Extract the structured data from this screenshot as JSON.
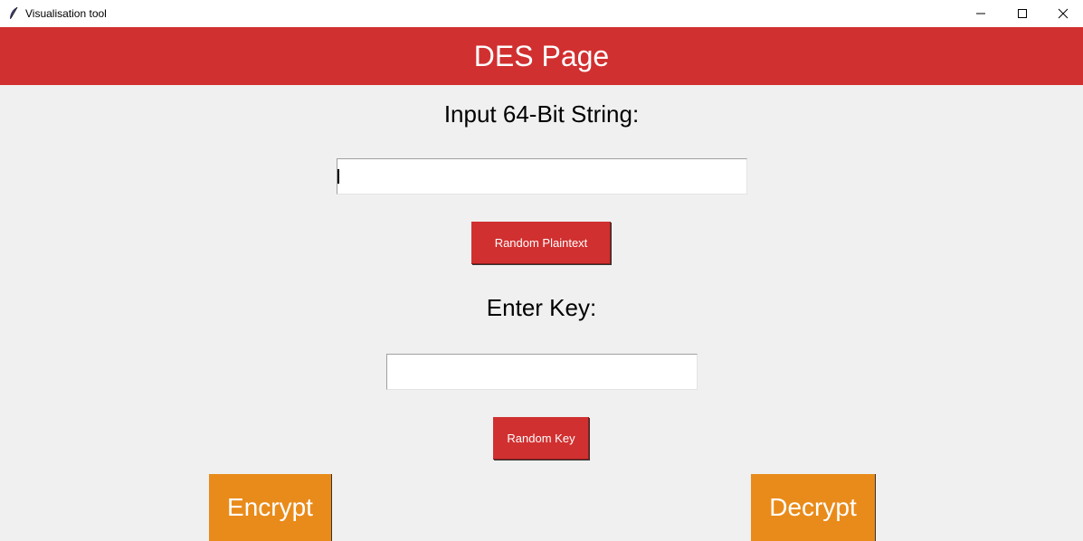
{
  "window": {
    "title": "Visualisation tool",
    "icon": "feather-icon",
    "controls": [
      "minimize-icon",
      "maximize-icon",
      "close-icon"
    ]
  },
  "header": {
    "title": "DES Page",
    "background": "#d13030"
  },
  "plaintext": {
    "label": "Input 64-Bit String:",
    "value": "",
    "placeholder": "",
    "random_button": "Random Plaintext"
  },
  "key": {
    "label": "Enter Key:",
    "value": "",
    "placeholder": "",
    "random_button": "Random Key"
  },
  "actions": {
    "encrypt": "Encrypt",
    "decrypt": "Decrypt",
    "color": "#e98b1a"
  }
}
